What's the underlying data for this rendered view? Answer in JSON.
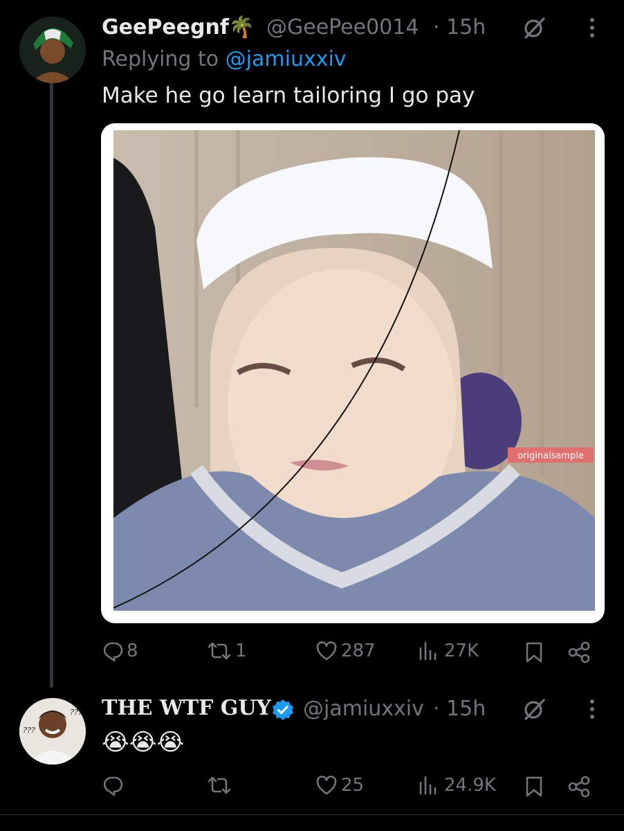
{
  "tweet1": {
    "display_name": "GeePeegnf",
    "name_emoji": "🌴",
    "handle": "@GeePee0014",
    "time": "· 15h",
    "replying_prefix": "Replying to ",
    "replying_handle": "@jamiuxxiv",
    "text": "Make he go learn tailoring I go pay",
    "media": {
      "watermark": "originalsample"
    },
    "actions": {
      "replies": "8",
      "retweets": "1",
      "likes": "287",
      "views": "27K"
    }
  },
  "tweet2": {
    "display_name": "THE WTF GUY",
    "handle": "@jamiuxxiv",
    "time": "· 15h",
    "text": "😭😭😭",
    "avatar_text": "???",
    "actions": {
      "replies": "",
      "retweets": "",
      "likes": "25",
      "views": "24.9K"
    }
  },
  "colors": {
    "background": "#000000",
    "primary_text": "#e7e9ea",
    "muted": "#71767b",
    "link": "#1d9bf0",
    "verified": "#1d9bf0"
  },
  "icons": [
    "grok-icon",
    "more-icon",
    "reply-icon",
    "retweet-icon",
    "like-icon",
    "views-icon",
    "bookmark-icon",
    "share-icon",
    "verified-badge-icon"
  ]
}
